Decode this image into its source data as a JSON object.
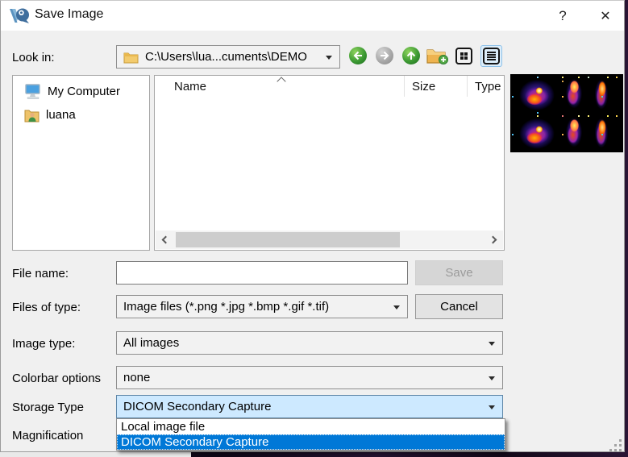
{
  "window": {
    "title": "Save Image",
    "help_label": "?",
    "close_label": "✕"
  },
  "look_in": {
    "label": "Look in:",
    "value": "C:\\Users\\lua...cuments\\DEMO"
  },
  "toolbar_icons": {
    "back": "arrow-left",
    "forward": "arrow-right",
    "up": "arrow-up",
    "new_folder": "folder-plus",
    "grid_view": "grid",
    "list_view": "list-selected"
  },
  "sidebar": {
    "items": [
      {
        "icon": "computer-icon",
        "label": "My Computer"
      },
      {
        "icon": "user-folder-icon",
        "label": "luana"
      }
    ]
  },
  "file_list": {
    "columns": [
      {
        "label": "Name"
      },
      {
        "label": "Size"
      },
      {
        "label": "Type"
      }
    ],
    "rows": [],
    "sort_column": "Name",
    "sort_indicator": "ascending"
  },
  "preview": {
    "icon": "medical-scan-thumbnail"
  },
  "form": {
    "file_name": {
      "label": "File name:",
      "value": ""
    },
    "files_of_type": {
      "label": "Files of type:",
      "value": "Image files (*.png *.jpg *.bmp *.gif *.tif)"
    },
    "image_type": {
      "label": "Image type:",
      "value": "All images"
    },
    "colorbar_options": {
      "label": "Colorbar options",
      "value": "none"
    },
    "storage_type": {
      "label": "Storage Type",
      "value": "DICOM Secondary Capture",
      "options": [
        "Local image file",
        "DICOM Secondary Capture"
      ],
      "highlighted_option": "DICOM Secondary Capture"
    },
    "magnification": {
      "label": "Magnification"
    }
  },
  "actions": {
    "save": "Save",
    "cancel": "Cancel"
  },
  "colors": {
    "selection_blue": "#0078d7",
    "focused_combo_bg": "#cde9ff",
    "dialog_bg": "#f0f0f0",
    "titlebar_bg": "#ffffff",
    "nav_green": "#3c9a33"
  }
}
